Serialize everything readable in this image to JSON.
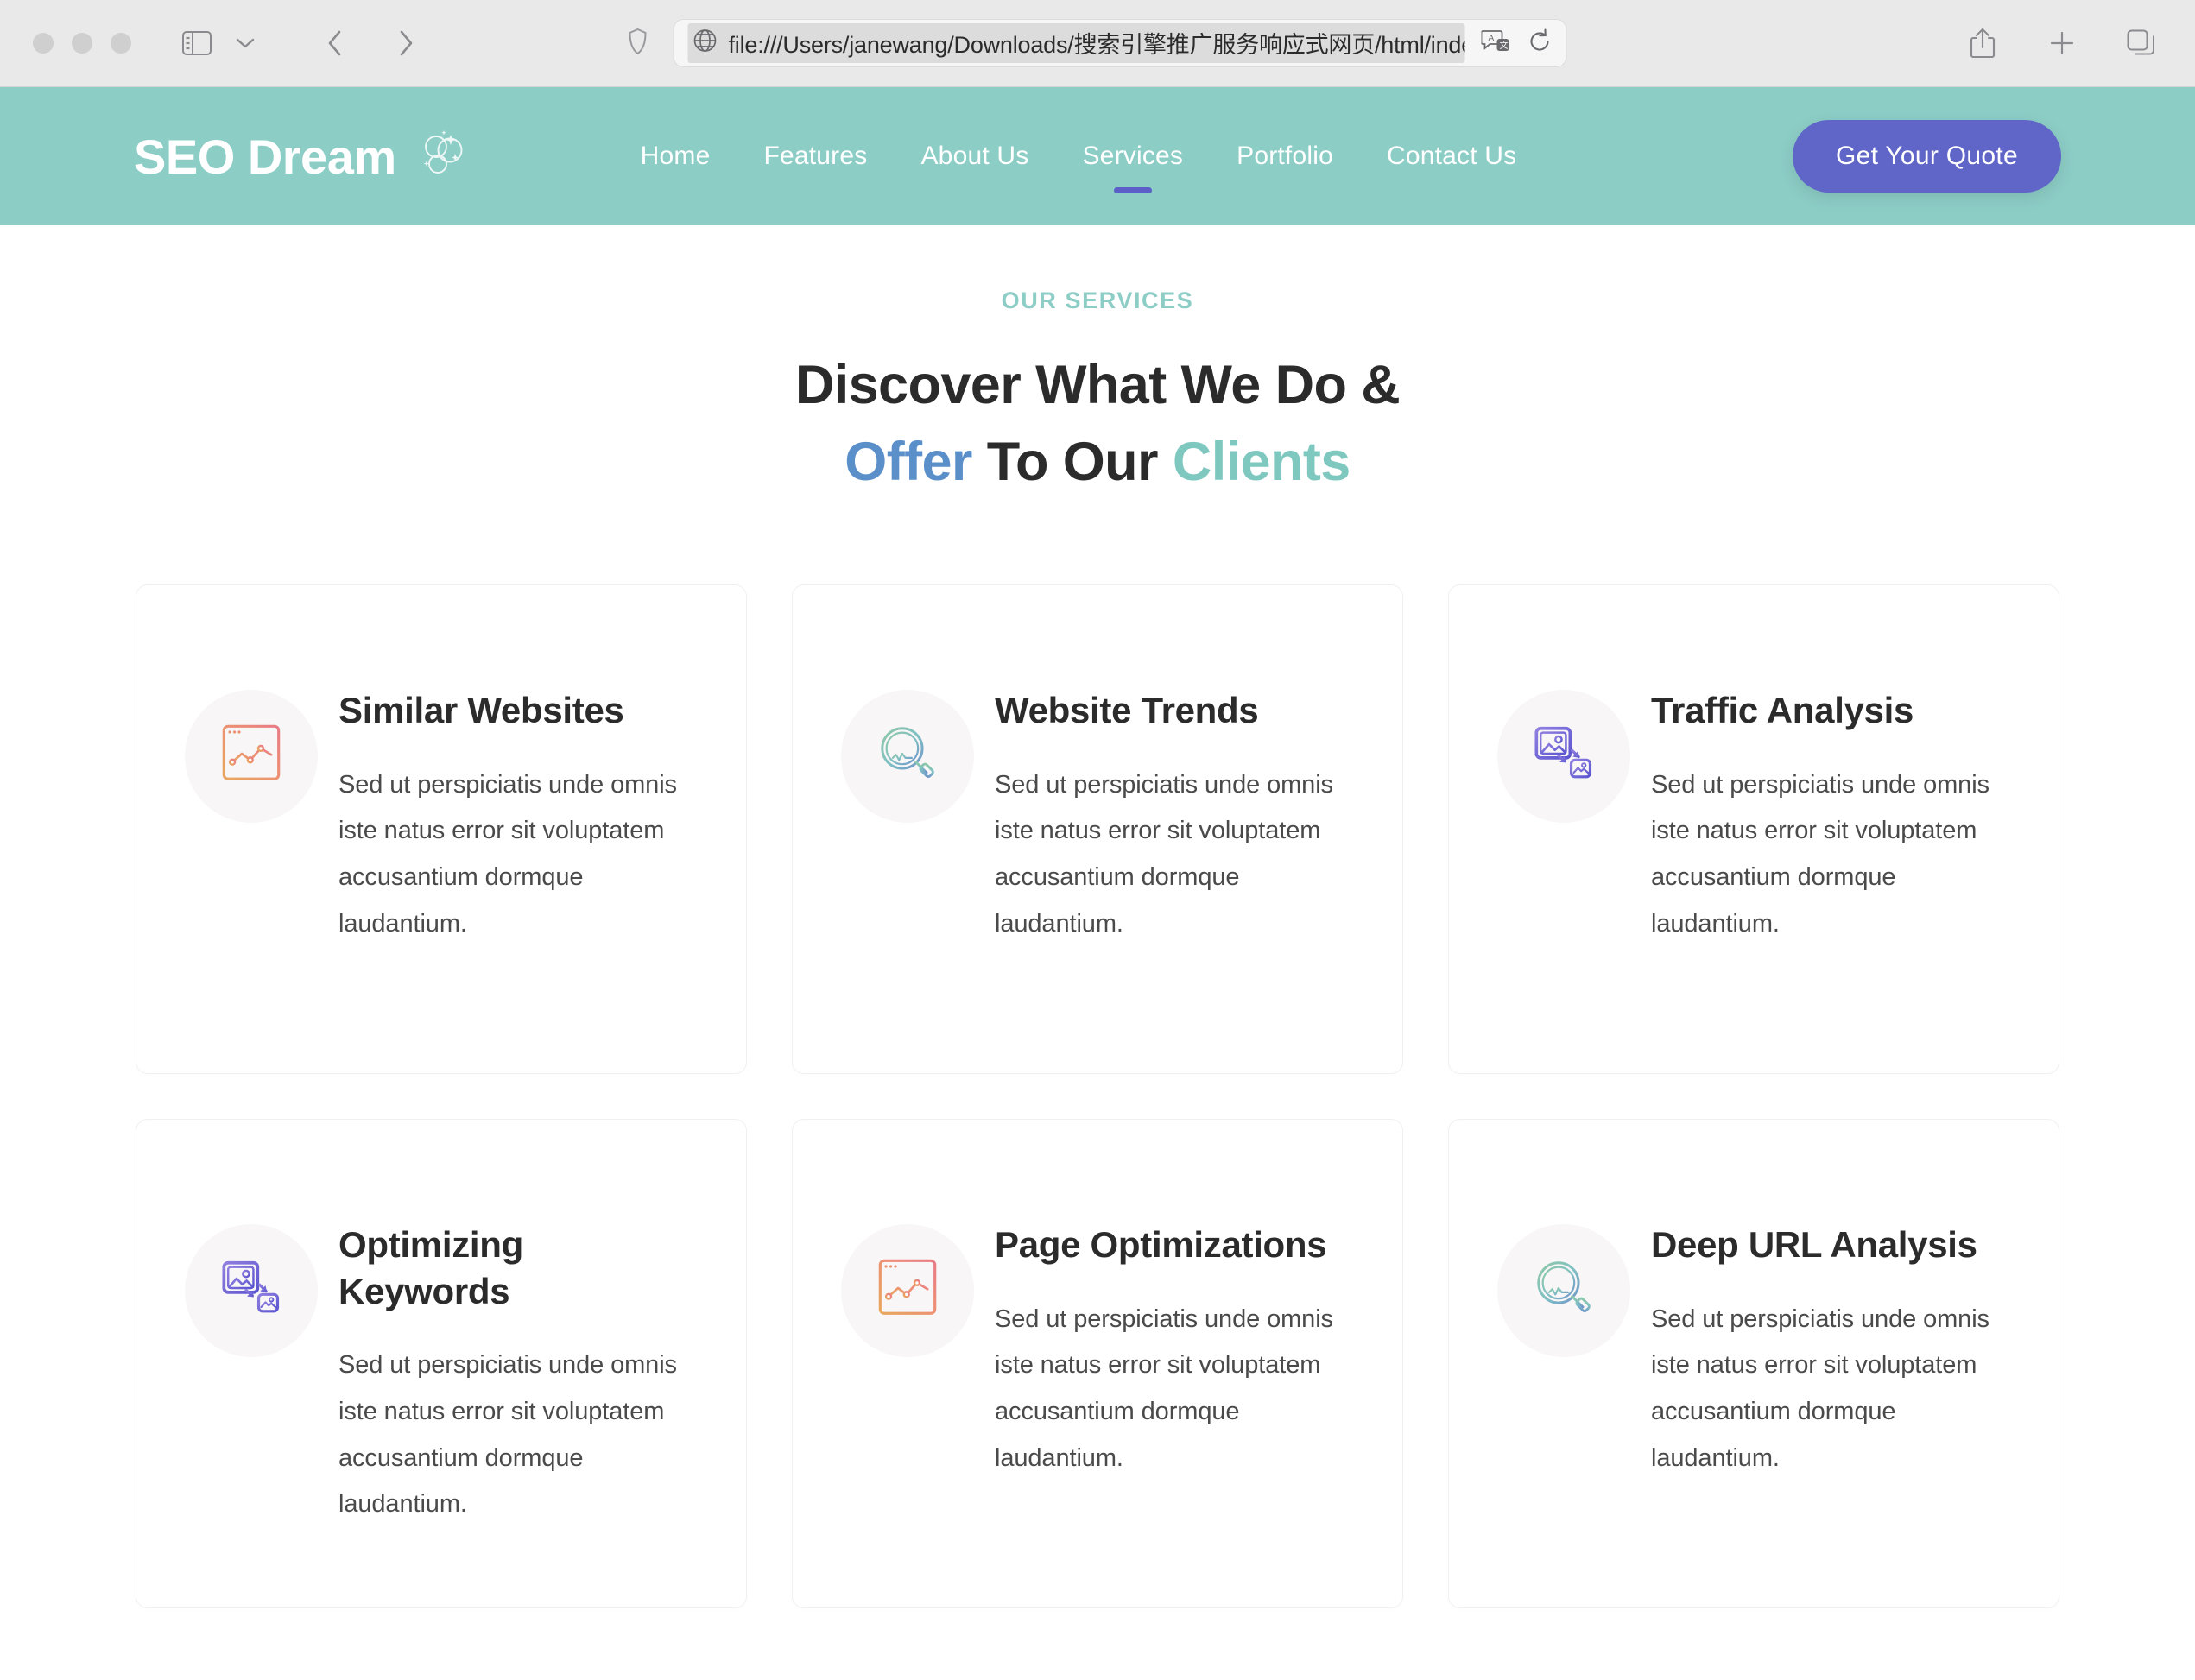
{
  "browser": {
    "url": "file:///Users/janewang/Downloads/搜索引擎推广服务响应式网页/html/inde",
    "sidebar_icon": "sidebar-icon",
    "chevron_icon": "chevron-down-icon",
    "back_icon": "back-arrow-icon",
    "forward_icon": "forward-arrow-icon",
    "shield_icon": "shield-icon",
    "globe_icon": "globe-icon",
    "translate_icon": "translate-icon",
    "reload_icon": "reload-icon",
    "share_icon": "share-icon",
    "new_tab_icon": "plus-icon",
    "tab_overview_icon": "tab-overview-icon"
  },
  "site": {
    "brand": "SEO Dream",
    "brand_icon": "sparkle-bubbles-icon",
    "nav": [
      {
        "label": "Home",
        "active": false
      },
      {
        "label": "Features",
        "active": false
      },
      {
        "label": "About Us",
        "active": false
      },
      {
        "label": "Services",
        "active": true
      },
      {
        "label": "Portfolio",
        "active": false
      },
      {
        "label": "Contact Us",
        "active": false
      }
    ],
    "cta": "Get Your Quote",
    "colors": {
      "header_bg": "#8ccdc6",
      "cta_bg": "#6065c8",
      "accent_teal": "#8ccdc6",
      "accent_blue": "#5b8fc9",
      "active_underline": "#5b5fc7"
    }
  },
  "services": {
    "eyebrow": "OUR SERVICES",
    "title_line1": "Discover What We Do &",
    "title_line2_a": "Offer",
    "title_line2_b": " To Our ",
    "title_line2_c": "Clients",
    "cards": [
      {
        "title": "Similar Websites",
        "desc": "Sed ut perspiciatis unde omnis iste natus error sit voluptatem accusantium dormque laudantium.",
        "icon": "browser-chart-icon",
        "icon_theme": "orange"
      },
      {
        "title": "Website Trends",
        "desc": "Sed ut perspiciatis unde omnis iste natus error sit voluptatem accusantium dormque laudantium.",
        "icon": "magnifier-chart-icon",
        "icon_theme": "teal"
      },
      {
        "title": "Traffic Analysis",
        "desc": "Sed ut perspiciatis unde omnis iste natus error sit voluptatem accusantium dormque laudantium.",
        "icon": "image-transfer-icon",
        "icon_theme": "purple"
      },
      {
        "title": "Optimizing Keywords",
        "desc": "Sed ut perspiciatis unde omnis iste natus error sit voluptatem accusantium dormque laudantium.",
        "icon": "image-transfer-icon",
        "icon_theme": "purple"
      },
      {
        "title": "Page Optimizations",
        "desc": "Sed ut perspiciatis unde omnis iste natus error sit voluptatem accusantium dormque laudantium.",
        "icon": "browser-chart-icon",
        "icon_theme": "orange"
      },
      {
        "title": "Deep URL Analysis",
        "desc": "Sed ut perspiciatis unde omnis iste natus error sit voluptatem accusantium dormque laudantium.",
        "icon": "magnifier-chart-icon",
        "icon_theme": "teal"
      }
    ]
  }
}
